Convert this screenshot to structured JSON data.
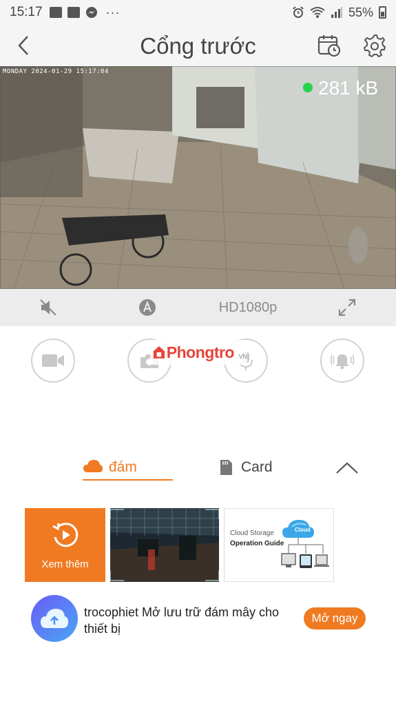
{
  "status_bar": {
    "time": "15:17",
    "overflow": "···",
    "battery": "55%",
    "icons": [
      "gallery-icon",
      "baomoi-icon",
      "messenger-icon",
      "alarm-icon",
      "wifi-icon",
      "signal-icon",
      "battery-icon"
    ]
  },
  "header": {
    "title": "Cổng trước",
    "back_icon": "chevron-left-icon",
    "calendar_icon": "calendar-clock-icon",
    "settings_icon": "gear-icon"
  },
  "video": {
    "timestamp": "MONDAY 2024-01-29 15:17:04",
    "bitrate": "281 kB",
    "live_color": "#27d24a"
  },
  "control_bar": {
    "quality": "HD1080p",
    "icons": [
      "mute-icon",
      "auto-icon",
      "fullscreen-icon"
    ]
  },
  "actions": {
    "icons": [
      "record-video-icon",
      "snapshot-icon",
      "microphone-icon",
      "alarm-bell-icon"
    ]
  },
  "watermark": {
    "text": "Phongtro",
    "suffix": ".VN"
  },
  "tabs": {
    "cloud": "đám",
    "card": "Card",
    "active_color": "#f07a21"
  },
  "tiles": {
    "more_label": "Xem thêm",
    "guide_line1": "Cloud Storage",
    "guide_line2": "Operation Guide",
    "guide_cloud": "Cloud"
  },
  "promo": {
    "text": "trocophiet Mở lưu trữ đám mây cho thiết bị",
    "button": "Mở ngay"
  },
  "colors": {
    "accent": "#f07a21",
    "background": "#ffffff",
    "bar": "#ececec"
  }
}
